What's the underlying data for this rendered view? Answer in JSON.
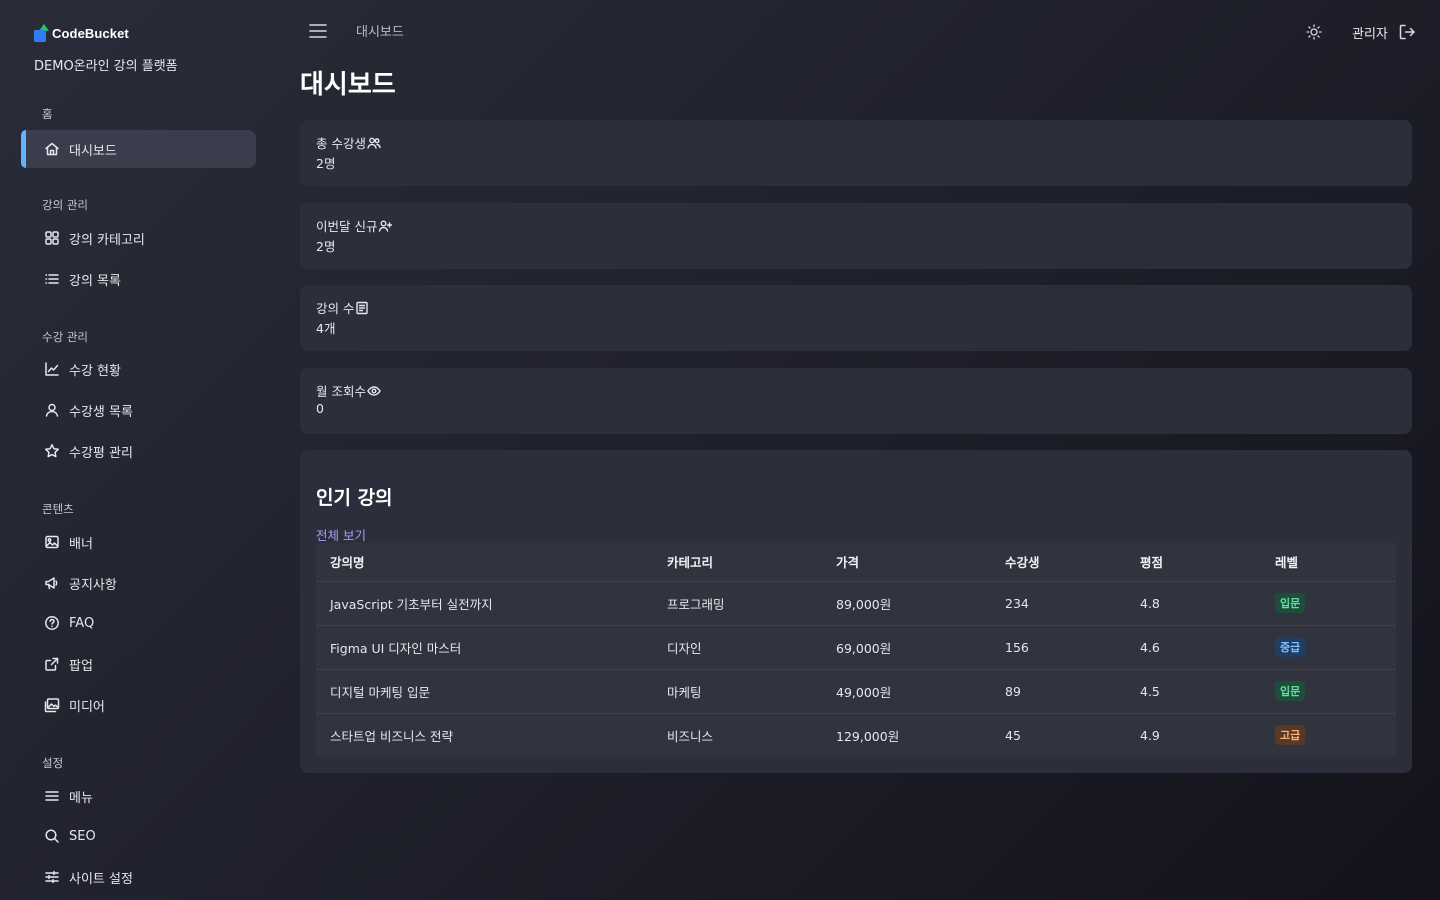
{
  "brand": {
    "name": "CodeBucket",
    "site_name": "DEMO온라인 강의 플랫폼"
  },
  "sidebar": {
    "sections": [
      {
        "label": "홈",
        "items": [
          {
            "label": "대시보드",
            "icon": "home-icon",
            "active": true
          }
        ]
      },
      {
        "label": "강의 관리",
        "items": [
          {
            "label": "강의 카테고리",
            "icon": "grid-icon"
          },
          {
            "label": "강의 목록",
            "icon": "list-icon"
          }
        ]
      },
      {
        "label": "수강 관리",
        "items": [
          {
            "label": "수강 현황",
            "icon": "chart-line-icon"
          },
          {
            "label": "수강생 목록",
            "icon": "user-icon"
          },
          {
            "label": "수강평 관리",
            "icon": "star-icon"
          }
        ]
      },
      {
        "label": "콘텐츠",
        "items": [
          {
            "label": "배너",
            "icon": "image-icon"
          },
          {
            "label": "공지사항",
            "icon": "megaphone-icon"
          },
          {
            "label": "FAQ",
            "icon": "question-icon"
          },
          {
            "label": "팝업",
            "icon": "popup-icon"
          },
          {
            "label": "미디어",
            "icon": "media-icon"
          }
        ]
      },
      {
        "label": "설정",
        "items": [
          {
            "label": "메뉴",
            "icon": "menu-icon"
          },
          {
            "label": "SEO",
            "icon": "search-icon"
          },
          {
            "label": "사이트 설정",
            "icon": "sliders-icon"
          }
        ]
      }
    ]
  },
  "topbar": {
    "breadcrumb": "대시보드",
    "user": "관리자"
  },
  "page": {
    "title": "대시보드"
  },
  "stats": [
    {
      "label": "총 수강생",
      "value": "2명",
      "icon": "users-icon"
    },
    {
      "label": "이번달 신규",
      "value": "2명",
      "icon": "user-plus-icon"
    },
    {
      "label": "강의 수",
      "value": "4개",
      "icon": "book-icon"
    },
    {
      "label": "월 조회수",
      "value": "0",
      "icon": "eye-icon"
    }
  ],
  "popular": {
    "title": "인기 강의",
    "view_all": "전체 보기",
    "columns": [
      "강의명",
      "카테고리",
      "가격",
      "수강생",
      "평점",
      "레벨"
    ],
    "rows": [
      {
        "name": "JavaScript 기초부터 실전까지",
        "category": "프로그래밍",
        "price": "89,000원",
        "students": "234",
        "rating": "4.8",
        "level": "입문",
        "level_key": "beginner"
      },
      {
        "name": "Figma UI 디자인 마스터",
        "category": "디자인",
        "price": "69,000원",
        "students": "156",
        "rating": "4.6",
        "level": "중급",
        "level_key": "intermediate"
      },
      {
        "name": "디지털 마케팅 입문",
        "category": "마케팅",
        "price": "49,000원",
        "students": "89",
        "rating": "4.5",
        "level": "입문",
        "level_key": "beginner"
      },
      {
        "name": "스타트업 비즈니스 전략",
        "category": "비즈니스",
        "price": "129,000원",
        "students": "45",
        "rating": "4.9",
        "level": "고급",
        "level_key": "advanced"
      }
    ]
  },
  "colors": {
    "accent": "#5fb3ff",
    "link": "#a89cf5",
    "card": "#2c2e3b"
  }
}
